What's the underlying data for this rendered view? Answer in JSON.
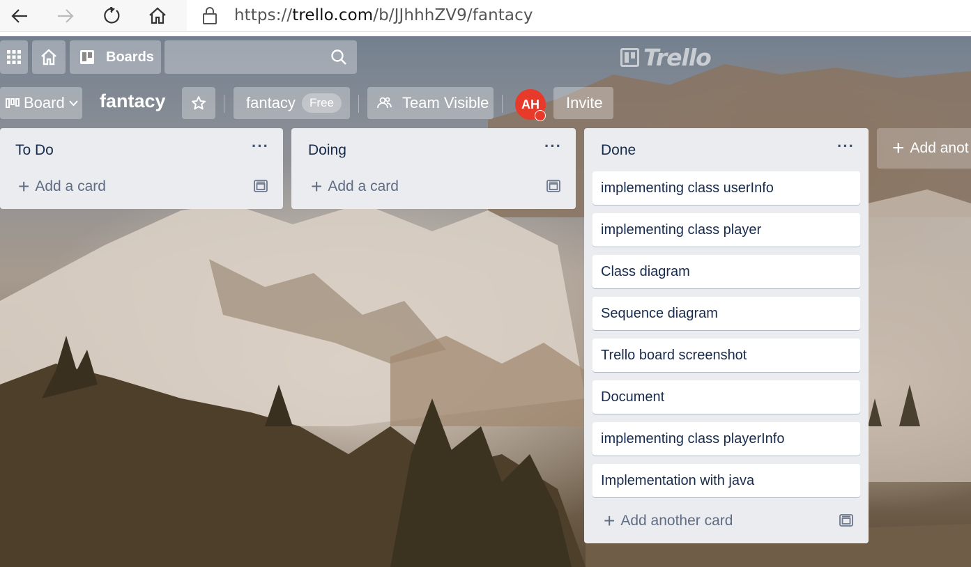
{
  "browser": {
    "url_prefix": "https://",
    "url_host": "trello.com",
    "url_path": "/b/JJhhhZV9/fantacy"
  },
  "header": {
    "boards_label": "Boards",
    "logo_text": "Trello"
  },
  "board": {
    "view_label": "Board",
    "name": "fantacy",
    "team_name": "fantacy",
    "plan_badge": "Free",
    "visibility_label": "Team Visible",
    "avatar_initials": "AH",
    "invite_label": "Invite"
  },
  "lists": [
    {
      "title": "To Do",
      "menu": "···",
      "add_label": "Add a card",
      "cards": []
    },
    {
      "title": "Doing",
      "menu": "···",
      "add_label": "Add a card",
      "cards": []
    },
    {
      "title": "Done",
      "menu": "···",
      "add_label": "Add another card",
      "cards": [
        "implementing class userInfo",
        "implementing class player",
        "Class diagram",
        "Sequence diagram",
        "Trello board screenshot",
        "Document",
        "implementing class playerInfo",
        "Implementation with java"
      ]
    }
  ],
  "add_list_label": "Add anot",
  "colors": {
    "avatar_red": "#e83a2b",
    "list_bg": "#ebecf0",
    "card_text": "#172b4d"
  },
  "icons": [
    "back-arrow-icon",
    "forward-arrow-icon",
    "refresh-icon",
    "home-icon",
    "lock-icon",
    "apps-grid-icon",
    "search-icon",
    "star-icon",
    "team-visible-icon",
    "card-template-icon"
  ]
}
